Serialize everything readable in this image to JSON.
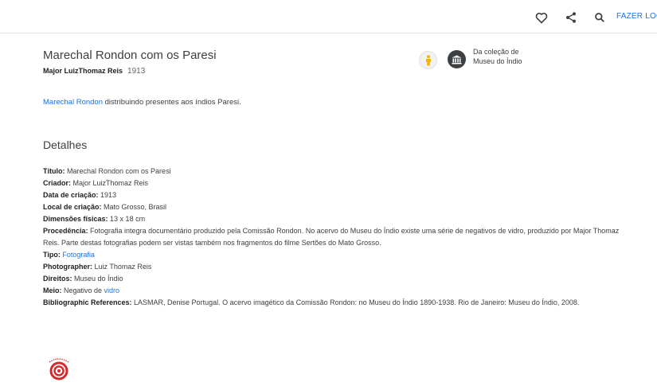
{
  "header": {
    "login_label": "FAZER LOGIN"
  },
  "artwork": {
    "title": "Marechal Rondon com os Paresi",
    "creator": "Major LuizThomaz Reis",
    "year": "1913"
  },
  "collection": {
    "line1": "Da coleção de",
    "line2": "Museu do Índio"
  },
  "description": {
    "link_text": "Marechal Rondon",
    "rest": " distribuindo presentes aos índios Paresi."
  },
  "details": {
    "heading": "Detalhes",
    "titulo_label": "Título:",
    "titulo_value": " Marechal Rondon com os Paresi",
    "criador_label": "Criador:",
    "criador_value": " Major LuizThomaz Reis",
    "data_label": "Data de criação:",
    "data_value": " 1913",
    "local_label": "Local de criação:",
    "local_value": " Mato Grosso, Brasil",
    "dimensoes_label": "Dimensões físicas:",
    "dimensoes_value": " 13 x 18 cm",
    "procedencia_label": "Procedência:",
    "procedencia_value": " Fotografia integra documentário produzido pela Comissão Rondon. No acervo do Museu do Índio existe uma série de negativos de vidro, produzido por Major Thomaz Reis. Parte destas fotografias podem ser vistas também nos fragmentos do filme Sertões do Mato Grosso.",
    "tipo_label": "Tipo:",
    "tipo_link": "Fotografia",
    "photographer_label": "Photographer:",
    "photographer_value": " Luiz Thomaz Reis",
    "direitos_label": "Direitos:",
    "direitos_value": " Museu do Índio",
    "meio_label": "Meio:",
    "meio_value": " Negativo de ",
    "meio_link": "vidro",
    "biblio_label": "Bibliographic References:",
    "biblio_value": " LASMAR, Denise Portugal. O acervo imagético da Comissão Rondon: no Museu do Índio 1890-1938. Rio de Janeiro: Museu do Índio, 2008."
  },
  "logo": {
    "text": "Museu do Índio"
  },
  "colors": {
    "accent": "#1a73e8",
    "logo_red": "#d52b2b",
    "person_badge": "#f5b400"
  },
  "icons": [
    "heart-icon",
    "share-icon",
    "search-icon",
    "person-icon",
    "museum-icon"
  ]
}
